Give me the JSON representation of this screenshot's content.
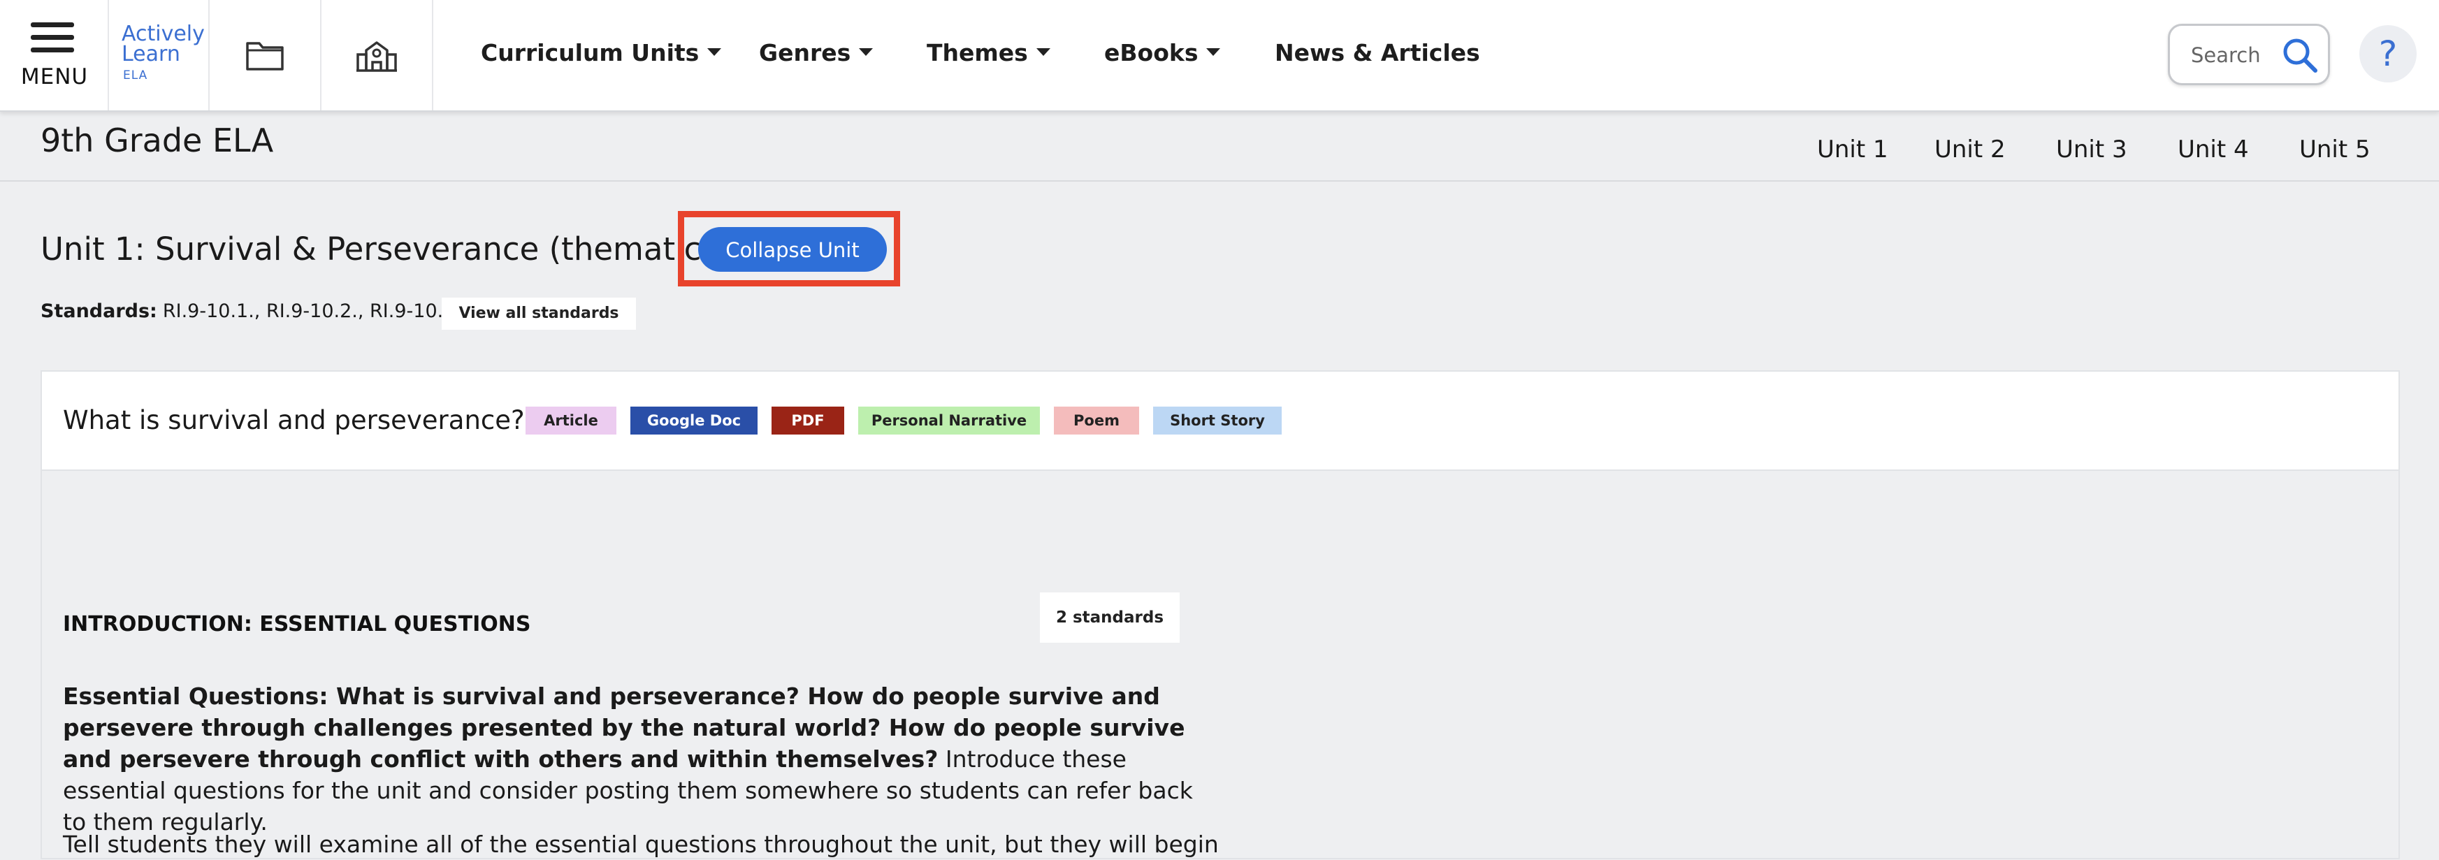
{
  "nav": {
    "menu_label": "MENU",
    "logo": {
      "line1": "Actively",
      "line2": "Learn",
      "line3": "ELA"
    },
    "items": [
      {
        "label": "Curriculum Units",
        "dropdown": true
      },
      {
        "label": "Genres",
        "dropdown": true
      },
      {
        "label": "Themes",
        "dropdown": true
      },
      {
        "label": "eBooks",
        "dropdown": true
      },
      {
        "label": "News & Articles",
        "dropdown": false
      }
    ],
    "search_placeholder": "Search",
    "help_label": "?"
  },
  "gradebar": {
    "title": "9th Grade ELA",
    "units": [
      "Unit 1",
      "Unit 2",
      "Unit 3",
      "Unit 4",
      "Unit 5"
    ]
  },
  "unit": {
    "title": "Unit 1: Survival & Perseverance (thematic)",
    "collapse_label": "Collapse Unit",
    "standards_label": "Standards:",
    "standards_value": "RI.9-10.1., RI.9-10.2., RI.9-10.3.",
    "view_standards_label": "View all standards"
  },
  "card": {
    "question": "What is survival and perseverance?",
    "tags": [
      {
        "label": "Article",
        "bg": "#ecccf0",
        "fg": "#222222"
      },
      {
        "label": "Google Doc",
        "bg": "#2a4fa8",
        "fg": "#ffffff"
      },
      {
        "label": "PDF",
        "bg": "#9a2416",
        "fg": "#ffffff"
      },
      {
        "label": "Personal Narrative",
        "bg": "#bdefae",
        "fg": "#222222"
      },
      {
        "label": "Poem",
        "bg": "#f4bcbc",
        "fg": "#222222"
      },
      {
        "label": "Short Story",
        "bg": "#bcd7f4",
        "fg": "#222222"
      }
    ],
    "section_heading": "INTRODUCTION: ESSENTIAL QUESTIONS",
    "standards_badge": "2 standards",
    "para1_bold": "Essential Questions: What is survival and perseverance? How do people survive and persevere through challenges presented by the natural world? How do people survive and persevere through conflict with others and within themselves?",
    "para1_rest": " Introduce these essential questions for the unit and consider posting them somewhere so students can refer back to them regularly.",
    "para2": "Tell students they will examine all of the essential questions throughout the unit, but they will begin"
  },
  "colors": {
    "accent": "#2e6fd8",
    "highlight_frame": "#e8432c",
    "logo_blue": "#3b6fd1"
  }
}
